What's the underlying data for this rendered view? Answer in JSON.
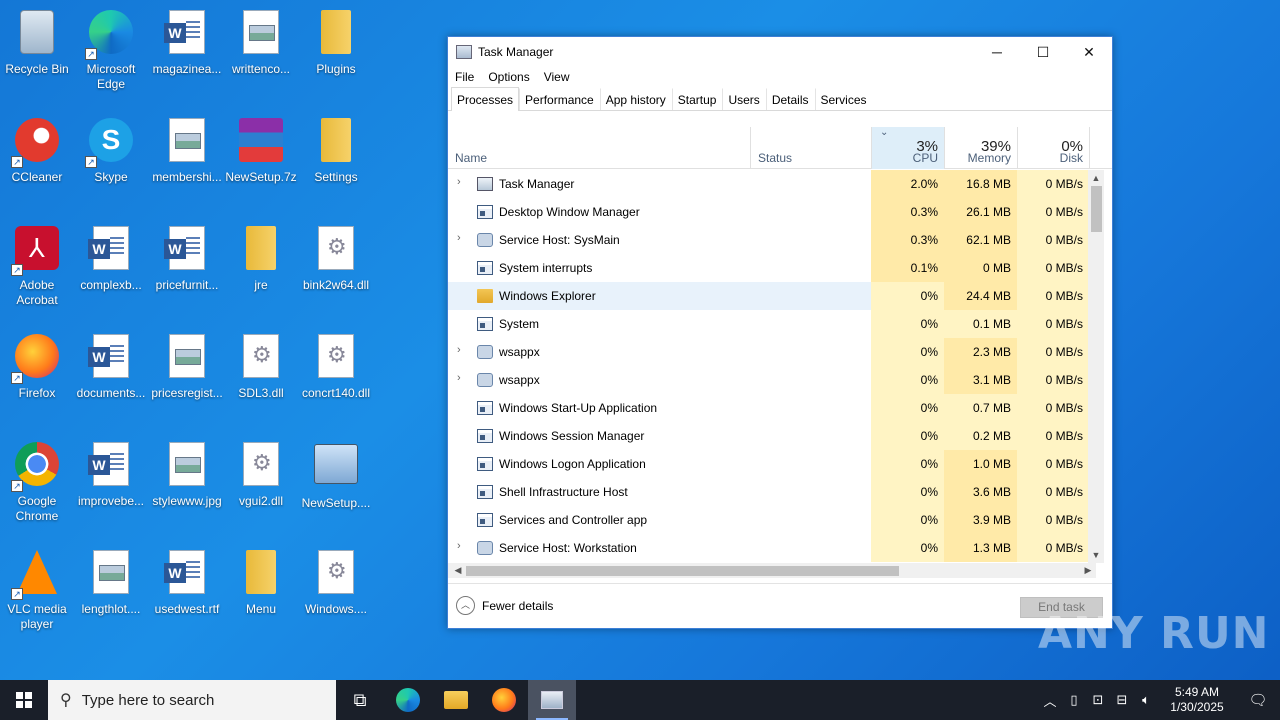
{
  "desktop": {
    "icons": [
      {
        "label": "Recycle Bin",
        "kind": "recycle"
      },
      {
        "label": "Microsoft Edge",
        "kind": "edge"
      },
      {
        "label": "magazinea...",
        "kind": "word"
      },
      {
        "label": "writtenco...",
        "kind": "image"
      },
      {
        "label": "Plugins",
        "kind": "folder"
      },
      {
        "label": "CCleaner",
        "kind": "ccleaner"
      },
      {
        "label": "Skype",
        "kind": "skype"
      },
      {
        "label": "membershi...",
        "kind": "image"
      },
      {
        "label": "NewSetup.7z",
        "kind": "winrar"
      },
      {
        "label": "Settings",
        "kind": "folder"
      },
      {
        "label": "Adobe Acrobat",
        "kind": "acrobat"
      },
      {
        "label": "complexb...",
        "kind": "word"
      },
      {
        "label": "pricefurnit...",
        "kind": "word"
      },
      {
        "label": "jre",
        "kind": "folder"
      },
      {
        "label": "bink2w64.dll",
        "kind": "dll"
      },
      {
        "label": "Firefox",
        "kind": "firefox"
      },
      {
        "label": "documents...",
        "kind": "word"
      },
      {
        "label": "pricesregist...",
        "kind": "image"
      },
      {
        "label": "SDL3.dll",
        "kind": "dll"
      },
      {
        "label": "concrt140.dll",
        "kind": "dll"
      },
      {
        "label": "Google Chrome",
        "kind": "chrome"
      },
      {
        "label": "improvebe...",
        "kind": "word"
      },
      {
        "label": "stylewww.jpg",
        "kind": "image"
      },
      {
        "label": "vgui2.dll",
        "kind": "dll"
      },
      {
        "label": "NewSetup....",
        "kind": "setup"
      },
      {
        "label": "VLC media player",
        "kind": "vlc"
      },
      {
        "label": "lengthlot....",
        "kind": "image"
      },
      {
        "label": "usedwest.rtf",
        "kind": "word"
      },
      {
        "label": "Menu",
        "kind": "folder"
      },
      {
        "label": "Windows....",
        "kind": "dll"
      }
    ]
  },
  "task_manager": {
    "title": "Task Manager",
    "window_controls": {
      "minimize": "─",
      "maximize": "☐",
      "close": "✕"
    },
    "menu": [
      "File",
      "Options",
      "View"
    ],
    "tabs": [
      "Processes",
      "Performance",
      "App history",
      "Startup",
      "Users",
      "Details",
      "Services"
    ],
    "active_tab": "Processes",
    "columns": {
      "name": "Name",
      "status": "Status",
      "cpu": {
        "pct": "3%",
        "label": "CPU"
      },
      "memory": {
        "pct": "39%",
        "label": "Memory"
      },
      "disk": {
        "pct": "0%",
        "label": "Disk"
      }
    },
    "processes": [
      {
        "name": "Task Manager",
        "expandable": true,
        "icon": "taskmgr-icon",
        "cpu": "2.0%",
        "mem": "16.8 MB",
        "disk": "0 MB/s"
      },
      {
        "name": "Desktop Window Manager",
        "expandable": false,
        "icon": "window-icon",
        "cpu": "0.3%",
        "mem": "26.1 MB",
        "disk": "0 MB/s"
      },
      {
        "name": "Service Host: SysMain",
        "expandable": true,
        "icon": "gear-icon",
        "cpu": "0.3%",
        "mem": "62.1 MB",
        "disk": "0 MB/s"
      },
      {
        "name": "System interrupts",
        "expandable": false,
        "icon": "window-icon",
        "cpu": "0.1%",
        "mem": "0 MB",
        "disk": "0 MB/s"
      },
      {
        "name": "Windows Explorer",
        "expandable": false,
        "icon": "folder-icon",
        "cpu": "0%",
        "mem": "24.4 MB",
        "disk": "0 MB/s",
        "highlighted": true
      },
      {
        "name": "System",
        "expandable": false,
        "icon": "window-icon",
        "cpu": "0%",
        "mem": "0.1 MB",
        "disk": "0 MB/s"
      },
      {
        "name": "wsappx",
        "expandable": true,
        "icon": "gear-icon",
        "cpu": "0%",
        "mem": "2.3 MB",
        "disk": "0 MB/s"
      },
      {
        "name": "wsappx",
        "expandable": true,
        "icon": "gear-icon",
        "cpu": "0%",
        "mem": "3.1 MB",
        "disk": "0 MB/s"
      },
      {
        "name": "Windows Start-Up Application",
        "expandable": false,
        "icon": "window-icon",
        "cpu": "0%",
        "mem": "0.7 MB",
        "disk": "0 MB/s"
      },
      {
        "name": "Windows Session Manager",
        "expandable": false,
        "icon": "window-icon",
        "cpu": "0%",
        "mem": "0.2 MB",
        "disk": "0 MB/s"
      },
      {
        "name": "Windows Logon Application",
        "expandable": false,
        "icon": "window-icon",
        "cpu": "0%",
        "mem": "1.0 MB",
        "disk": "0 MB/s"
      },
      {
        "name": "Shell Infrastructure Host",
        "expandable": false,
        "icon": "window-icon",
        "cpu": "0%",
        "mem": "3.6 MB",
        "disk": "0 MB/s"
      },
      {
        "name": "Services and Controller app",
        "expandable": false,
        "icon": "window-icon",
        "cpu": "0%",
        "mem": "3.9 MB",
        "disk": "0 MB/s"
      },
      {
        "name": "Service Host: Workstation",
        "expandable": true,
        "icon": "gear-icon",
        "cpu": "0%",
        "mem": "1.3 MB",
        "disk": "0 MB/s"
      }
    ],
    "footer": {
      "fewer_details": "Fewer details",
      "end_task": "End task"
    }
  },
  "watermark": "ANY RUN",
  "taskbar": {
    "search_placeholder": "Type here to search",
    "clock_time": "5:49 AM",
    "clock_date": "1/30/2025"
  },
  "colors": {
    "accent": "#3d7fd6",
    "cpu_header_bg": "#deeef9",
    "heat_low": "#fff4c4",
    "heat_mid": "#ffeaa8",
    "taskbar": "#1a1f29"
  }
}
